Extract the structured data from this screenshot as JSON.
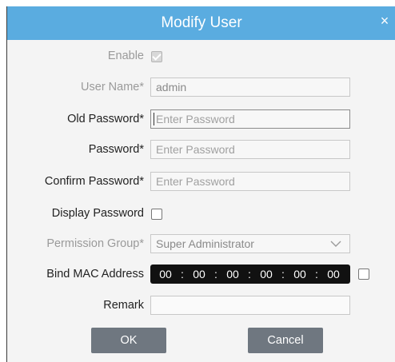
{
  "dialog": {
    "title": "Modify User",
    "close_glyph": "×"
  },
  "form": {
    "enable_label": "Enable",
    "enable_checked": true,
    "username_label": "User Name*",
    "username_value": "admin",
    "old_password_label": "Old Password*",
    "old_password_placeholder": "Enter Password",
    "password_label": "Password*",
    "password_placeholder": "Enter Password",
    "confirm_password_label": "Confirm Password*",
    "confirm_password_placeholder": "Enter Password",
    "display_password_label": "Display Password",
    "display_password_checked": false,
    "permission_group_label": "Permission Group*",
    "permission_group_value": "Super Administrator",
    "bind_mac_label": "Bind MAC Address",
    "mac_octets": [
      "00",
      "00",
      "00",
      "00",
      "00",
      "00"
    ],
    "mac_separator": ":",
    "bind_mac_checked": false,
    "remark_label": "Remark",
    "remark_value": ""
  },
  "buttons": {
    "ok_label": "OK",
    "cancel_label": "Cancel"
  },
  "colors": {
    "titlebar": "#5aace0",
    "button": "#6f7780",
    "mac_background": "#111111"
  }
}
